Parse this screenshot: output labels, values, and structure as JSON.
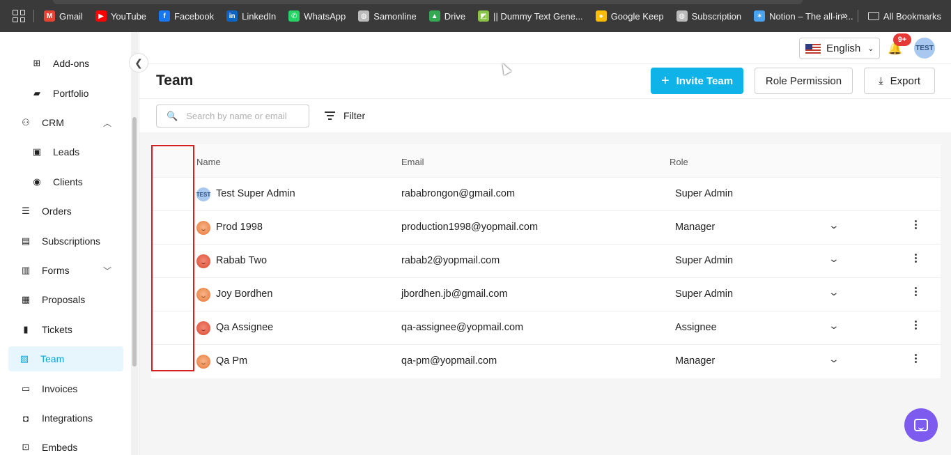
{
  "bookmarks": {
    "items": [
      {
        "label": "Gmail",
        "icon": "gmail-icon",
        "color": "#ea4335"
      },
      {
        "label": "YouTube",
        "icon": "youtube-icon",
        "color": "#ff0000"
      },
      {
        "label": "Facebook",
        "icon": "facebook-icon",
        "color": "#1877f2"
      },
      {
        "label": "LinkedIn",
        "icon": "linkedin-icon",
        "color": "#0a66c2"
      },
      {
        "label": "WhatsApp",
        "icon": "whatsapp-icon",
        "color": "#25d366"
      },
      {
        "label": "Samonline",
        "icon": "globe-icon",
        "color": "#bbbbbb"
      },
      {
        "label": "Drive",
        "icon": "drive-icon",
        "color": "#34a853"
      },
      {
        "label": "|| Dummy Text Gene...",
        "icon": "dummy-text-icon",
        "color": "#8bc34a"
      },
      {
        "label": "Google Keep",
        "icon": "keep-icon",
        "color": "#fbbc04"
      },
      {
        "label": "Subscription",
        "icon": "globe-icon",
        "color": "#bbbbbb"
      },
      {
        "label": "Notion – The all-in-...",
        "icon": "notion-icon",
        "color": "#4aa3f0"
      }
    ],
    "more": "»",
    "all_bookmarks": "All Bookmarks"
  },
  "sidebar": {
    "items": [
      {
        "label": "Add-ons",
        "icon": "add-box-icon",
        "sub": true
      },
      {
        "label": "Portfolio",
        "icon": "portfolio-icon",
        "sub": true
      },
      {
        "label": "CRM",
        "icon": "crm-icon",
        "chevron": "up"
      },
      {
        "label": "Leads",
        "icon": "leads-icon",
        "sub": true
      },
      {
        "label": "Clients",
        "icon": "clients-icon",
        "sub": true
      },
      {
        "label": "Orders",
        "icon": "orders-icon"
      },
      {
        "label": "Subscriptions",
        "icon": "subscriptions-icon"
      },
      {
        "label": "Forms",
        "icon": "forms-icon",
        "chevron": "down"
      },
      {
        "label": "Proposals",
        "icon": "proposals-icon"
      },
      {
        "label": "Tickets",
        "icon": "tickets-icon"
      },
      {
        "label": "Team",
        "icon": "team-icon",
        "active": true
      },
      {
        "label": "Invoices",
        "icon": "invoices-icon"
      },
      {
        "label": "Integrations",
        "icon": "integrations-icon"
      },
      {
        "label": "Embeds",
        "icon": "embeds-icon"
      }
    ]
  },
  "header": {
    "language": "English",
    "notifications_badge": "9+",
    "avatar_text": "TEST"
  },
  "page": {
    "title": "Team",
    "invite_label": "Invite Team",
    "role_permission_label": "Role Permission",
    "export_label": "Export",
    "search_placeholder": "Search by name or email",
    "filter_label": "Filter"
  },
  "table": {
    "headers": {
      "name": "Name",
      "email": "Email",
      "role": "Role"
    },
    "rows": [
      {
        "name": "Test Super Admin",
        "email": "rababrongon@gmail.com",
        "role": "Super Admin",
        "avatar": "test",
        "avatar_text": "TEST",
        "editable": false
      },
      {
        "name": "Prod 1998",
        "email": "production1998@yopmail.com",
        "role": "Manager",
        "avatar": "face",
        "editable": true
      },
      {
        "name": "Rabab Two",
        "email": "rabab2@yopmail.com",
        "role": "Super Admin",
        "avatar": "face-red",
        "editable": true
      },
      {
        "name": "Joy Bordhen",
        "email": "jbordhen.jb@gmail.com",
        "role": "Super Admin",
        "avatar": "face",
        "editable": true
      },
      {
        "name": "Qa Assignee",
        "email": "qa-assignee@yopmail.com",
        "role": "Assignee",
        "avatar": "face-red",
        "editable": true
      },
      {
        "name": "Qa Pm",
        "email": "qa-pm@yopmail.com",
        "role": "Manager",
        "avatar": "face",
        "editable": true
      }
    ]
  },
  "colors": {
    "accent": "#0fb3e8",
    "active_bg": "#e6f6fc",
    "highlight": "#d61f1f",
    "chat": "#7e5bef"
  }
}
